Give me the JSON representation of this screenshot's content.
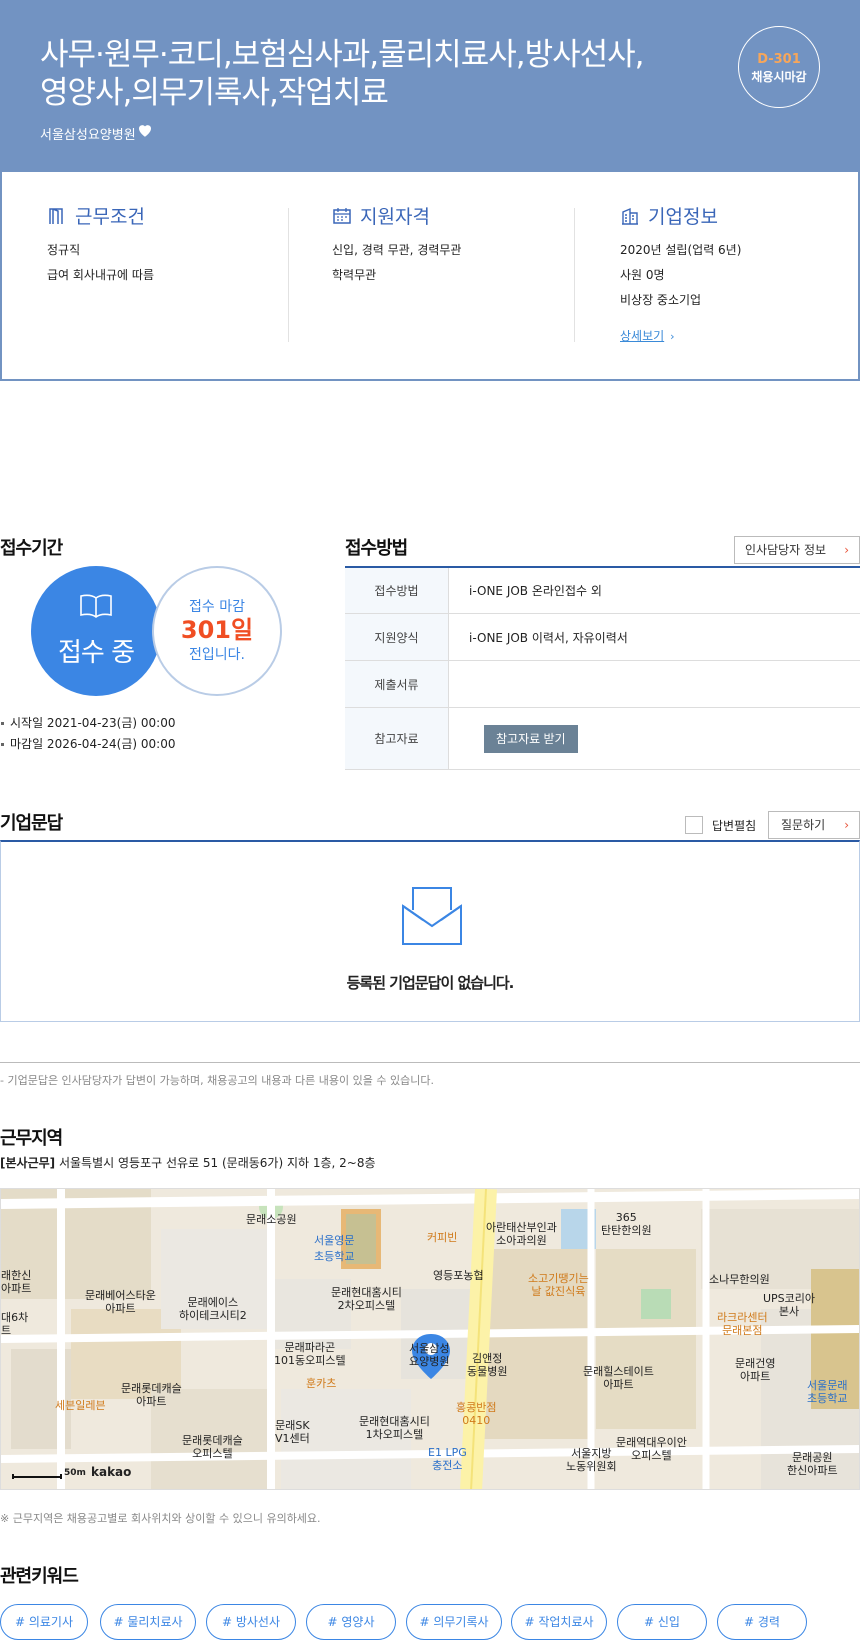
{
  "header": {
    "title_line1": "사무·원무·코디,보험심사과,물리치료사,방사선사,",
    "title_line2": "영양사,의무기록사,작업치료",
    "company": "서울삼성요양병원",
    "dday": "D-301",
    "deadline_type": "채용시마감"
  },
  "info": {
    "work": {
      "title": "근무조건",
      "items": [
        "정규직",
        "급여 회사내규에 따름"
      ]
    },
    "qualification": {
      "title": "지원자격",
      "items": [
        "신입, 경력 무관, 경력무관",
        "학력무관"
      ]
    },
    "company": {
      "title": "기업정보",
      "items": [
        "2020년 설립(업력 6년)",
        "사원 0명",
        "비상장 중소기업"
      ],
      "detail_link": "상세보기"
    }
  },
  "period": {
    "title": "접수기간",
    "status": "접수 중",
    "remain_prefix": "접수 마감",
    "remain_days": "301일",
    "remain_suffix": "전입니다.",
    "start": "시작일 2021-04-23(금) 00:00",
    "end": "마감일 2026-04-24(금) 00:00"
  },
  "method": {
    "title": "접수방법",
    "hr_button": "인사담당자 정보",
    "rows": [
      {
        "key": "접수방법",
        "value": "i-ONE JOB 온라인접수 외"
      },
      {
        "key": "지원양식",
        "value": "i-ONE JOB 이력서, 자유이력서"
      },
      {
        "key": "제출서류",
        "value": ""
      },
      {
        "key": "참고자료",
        "value": ""
      }
    ],
    "ref_button": "참고자료 받기"
  },
  "qa": {
    "title": "기업문답",
    "checkbox_label": "답변펼침",
    "ask_button": "질문하기",
    "empty_message": "등록된 기업문답이 없습니다.",
    "note": "- 기업문답은 인사담당자가 답변이 가능하며, 채용공고의 내용과 다른 내용이 있을 수 있습니다."
  },
  "location": {
    "title": "근무지역",
    "address_tag": "[본사근무]",
    "address": "서울특별시 영등포구 선유로 51 (문래동6가) 지하 1층, 2~8층",
    "map_scale": "50m",
    "map_logo": "kakao",
    "note": "※ 근무지역은 채용공고별로 회사위치와 상이할 수 있으니 유의하세요.",
    "map_labels": {
      "park": "문래소공원",
      "school1": "서울영문\n초등학교",
      "cafe": "커피빈",
      "clinic1": "아란태산부인과\n소아과의원",
      "clinic2": "365\n탄탄한의원",
      "church": "영등포농협",
      "food1": "소고기땡기는\n날 값진식육",
      "hospital": "서울삼성\n요양병원",
      "office1": "문래현대홈시티\n2차오피스텔",
      "apt1": "문래베어스타운\n아파트",
      "apt2": "문래에이스\n하이테크시티2",
      "office2": "문래파라곤\n101동오피스텔",
      "food2": "훈카츠",
      "animal": "김앤정\n동물병원",
      "apt3": "문래힐스테이트\n아파트",
      "apt4": "문래롯데캐슬\n아파트",
      "apt5": "문래롯데캐슬\n오피스텔",
      "center": "문래SK\nV1센터",
      "office3": "문래현대홈시티\n1차오피스텔",
      "food3": "홍콩반점\n0410",
      "gas": "E1 LPG\n충전소",
      "labor": "서울지방\n노동위원회",
      "office4": "문래역대우이안\n오피스텔",
      "apt6": "문래공원\n한신아파트",
      "school2": "서울문래\n초등학교",
      "ups": "UPS코리아\n본사",
      "clinic3": "소나무한의원",
      "lacra": "라크라센터\n문래본점",
      "apt7": "문래건영\n아파트",
      "food4": "세븐일레븐",
      "left1": "래한신\n아파트",
      "left2": "대6차\n트"
    }
  },
  "keywords": {
    "title": "관련키워드",
    "items": [
      "# 의료기사",
      "# 물리치료사",
      "# 방사선사",
      "# 영양사",
      "# 의무기록사",
      "# 작업치료사",
      "# 신입",
      "# 경력"
    ]
  },
  "colors": {
    "header_bg": "#7293c2",
    "accent_blue": "#3b86e4",
    "accent_red": "#f04e23",
    "table_border": "#2a5aa4"
  }
}
